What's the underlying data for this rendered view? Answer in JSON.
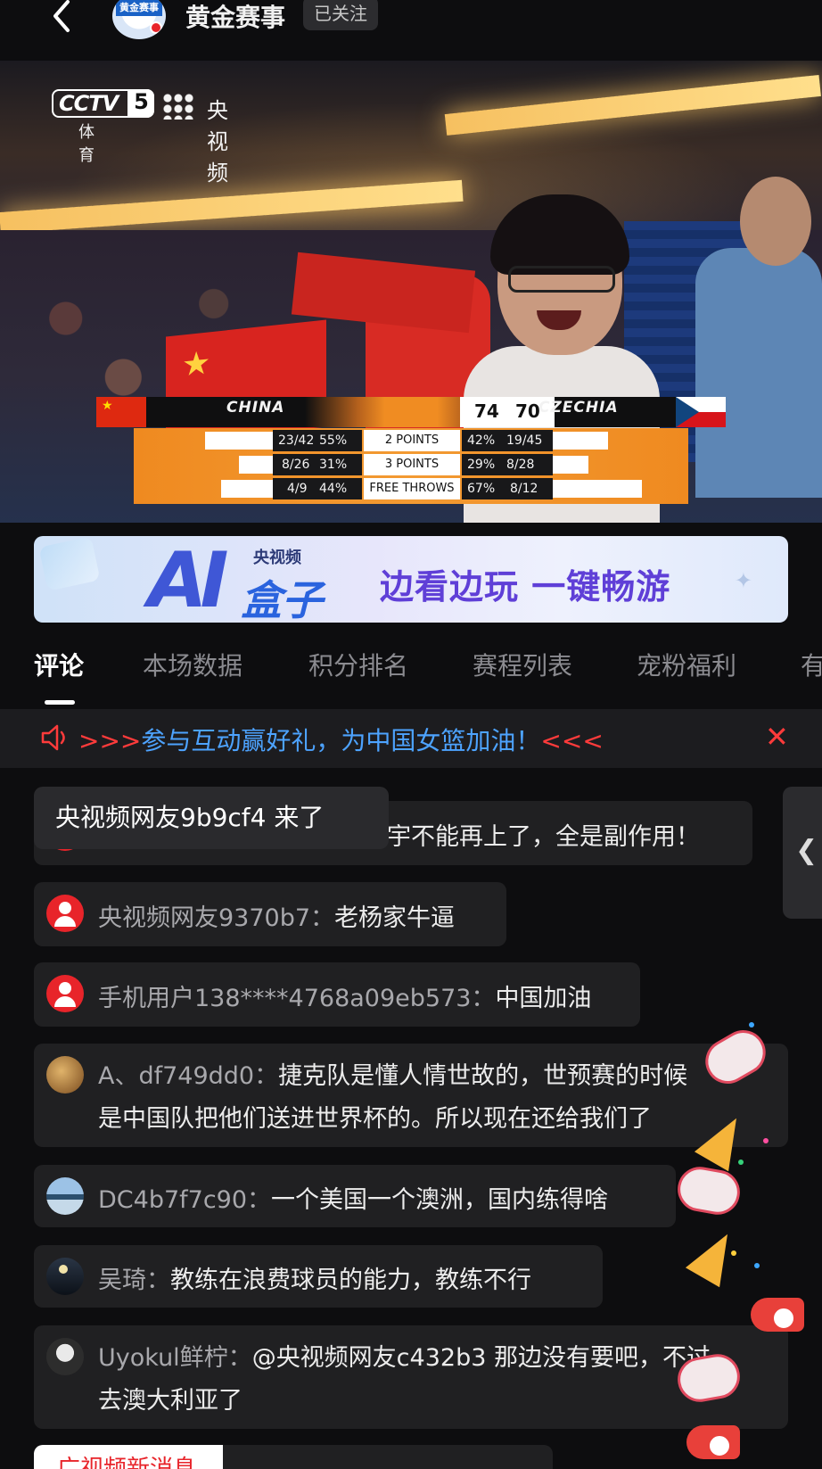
{
  "header": {
    "channel_name": "黄金赛事",
    "follow_status": "已关注",
    "avatar_text": "黄金赛事"
  },
  "video": {
    "watermark_channel": "CCTV",
    "watermark_channel_number": "5",
    "watermark_sub": "体育",
    "watermark_app": "央视频",
    "scoreboard": {
      "home_team": "CHINA",
      "away_team": "CZECHIA",
      "home_score": "74",
      "away_score": "70",
      "stats": [
        {
          "label": "2 POINTS",
          "home_att": "23/42",
          "home_pct": "55%",
          "away_pct": "42%",
          "away_att": "19/45",
          "home_bar_pct": 0.55,
          "away_bar_pct": 0.42
        },
        {
          "label": "3 POINTS",
          "home_att": "8/26",
          "home_pct": "31%",
          "away_pct": "29%",
          "away_att": "8/28",
          "home_bar_pct": 0.31,
          "away_bar_pct": 0.29
        },
        {
          "label": "FREE THROWS",
          "home_att": "4/9",
          "home_pct": "44%",
          "away_pct": "67%",
          "away_att": "8/12",
          "home_bar_pct": 0.44,
          "away_bar_pct": 0.67
        }
      ]
    }
  },
  "banner": {
    "logo_app": "央视频",
    "logo_ai": "AI",
    "logo_box": "盒子",
    "slogan": "边看边玩 一键畅游"
  },
  "tabs": [
    {
      "label": "评论",
      "active": true
    },
    {
      "label": "本场数据",
      "active": false
    },
    {
      "label": "积分排名",
      "active": false
    },
    {
      "label": "赛程列表",
      "active": false
    },
    {
      "label": "宠粉福利",
      "active": false
    },
    {
      "label": "有",
      "active": false
    }
  ],
  "notice": {
    "prefix": ">>>",
    "message": "参与互动赢好礼，为中国女篮加油！",
    "suffix": "<<<"
  },
  "join_toast": "央视频网友9b9cf4 来了",
  "comments": [
    {
      "user": "",
      "text": "宇不能再上了，全是副作用！",
      "avatar": "red"
    },
    {
      "user": "央视频网友9370b7：",
      "text": "老杨家牛逼",
      "avatar": "red"
    },
    {
      "user": "手机用户138****4768a09eb573：",
      "text": "中国加油",
      "avatar": "red"
    },
    {
      "user": "A、df749dd0：",
      "text": "捷克队是懂人情世故的，世预赛的时候",
      "text2": "是中国队把他们送进世界杯的。所以现在还给我们了",
      "avatar": "gold"
    },
    {
      "user": "DC4b7f7c90：",
      "text": "一个美国一个澳洲，国内练得啥",
      "avatar": "lake"
    },
    {
      "user": "吴琦：",
      "text": "教练在浪费球员的能力，教练不行",
      "avatar": "moon"
    },
    {
      "user": "Uyokul鲜柠：",
      "text": "@央视频网友c432b3 那边没有要吧，不过",
      "text2": "去澳大利亚了",
      "avatar": "bw"
    }
  ],
  "bottom_pill": "广视频新消息",
  "colors": {
    "background": "#0d0d0f",
    "accent_red": "#ff3b3b",
    "notice_blue": "#4da3ff",
    "scoreboard_orange": "#f08c22"
  }
}
